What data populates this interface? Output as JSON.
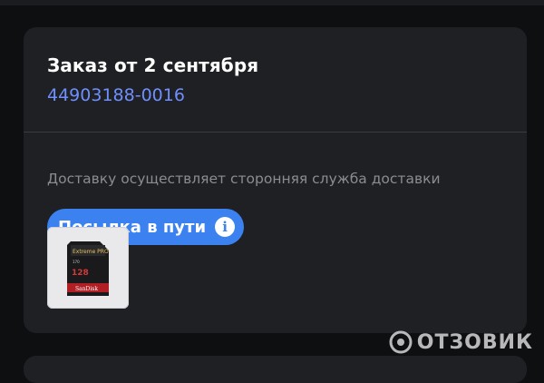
{
  "order": {
    "title": "Заказ от 2 сентября",
    "number": "44903188-0016",
    "delivery_note": "Доставку осуществляет сторонняя служба доставки",
    "status": "Посылка в пути",
    "info_glyph": "i"
  },
  "product": {
    "card_brand_line": "Extreme PRO",
    "capacity": "128",
    "speed": "170",
    "maker": "SanDisk"
  },
  "watermark": {
    "text": "ОТЗОВИК"
  },
  "colors": {
    "background": "#0e0f11",
    "card": "#1f2024",
    "accent_link": "#6f8fff",
    "status_pill": "#3b82f0"
  }
}
